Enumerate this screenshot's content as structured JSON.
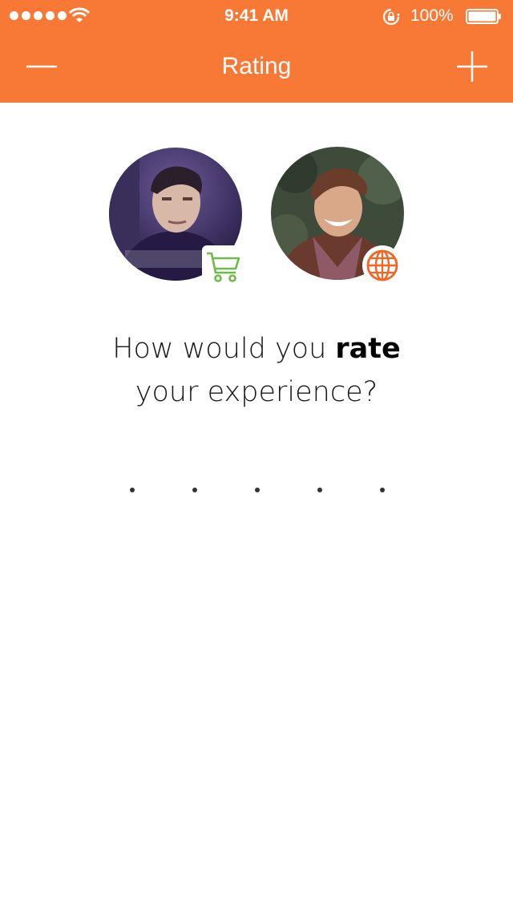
{
  "status_bar": {
    "time": "9:41 AM",
    "battery_percent": "100%",
    "signal_bars": 5,
    "icons": [
      "signal-dots-icon",
      "wifi-icon",
      "rotation-lock-icon",
      "battery-icon"
    ]
  },
  "nav": {
    "title": "Rating",
    "left_icon": "minus-icon",
    "right_icon": "plus-icon"
  },
  "colors": {
    "accent": "#F77935",
    "cart_badge": "#6DBB4A",
    "globe_badge": "#F26522"
  },
  "users": [
    {
      "badge_icon": "shopping-cart-icon"
    },
    {
      "badge_icon": "globe-icon"
    }
  ],
  "question": {
    "prefix": "How would you ",
    "emphasis": "rate",
    "line2": "your experience?"
  },
  "rating": {
    "max": 5,
    "value": 0
  }
}
